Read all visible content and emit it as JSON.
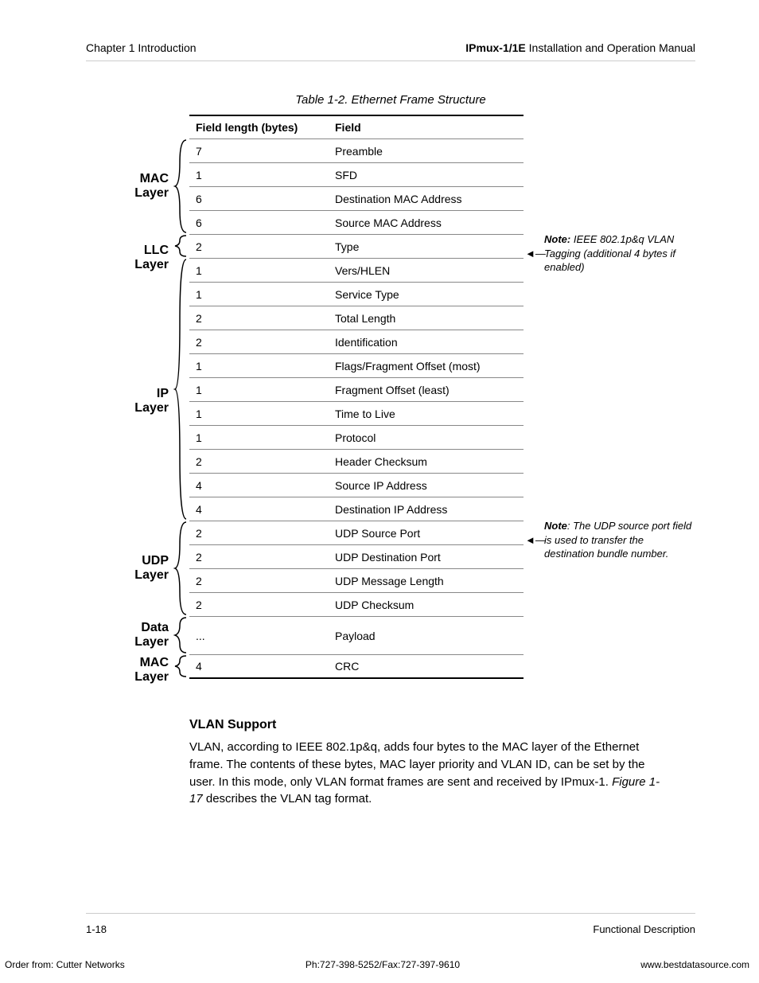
{
  "header": {
    "left": "Chapter 1  Introduction",
    "right_bold": "IPmux-1/1E",
    "right_rest": " Installation and Operation Manual"
  },
  "caption": "Table 1-2.  Ethernet Frame Structure",
  "table": {
    "head_c1": "Field length (bytes)",
    "head_c2": "Field",
    "rows": [
      {
        "len": "7",
        "field": "Preamble"
      },
      {
        "len": "1",
        "field": "SFD"
      },
      {
        "len": "6",
        "field": "Destination MAC Address"
      },
      {
        "len": "6",
        "field": "Source MAC Address"
      },
      {
        "len": "2",
        "field": "Type"
      },
      {
        "len": "1",
        "field": "Vers/HLEN"
      },
      {
        "len": "1",
        "field": "Service Type"
      },
      {
        "len": "2",
        "field": "Total Length"
      },
      {
        "len": "2",
        "field": "Identification"
      },
      {
        "len": "1",
        "field": "Flags/Fragment Offset (most)"
      },
      {
        "len": "1",
        "field": "Fragment Offset (least)"
      },
      {
        "len": "1",
        "field": "Time to Live"
      },
      {
        "len": "1",
        "field": "Protocol"
      },
      {
        "len": "2",
        "field": "Header Checksum"
      },
      {
        "len": "4",
        "field": "Source IP Address"
      },
      {
        "len": "4",
        "field": "Destination IP Address"
      },
      {
        "len": "2",
        "field": "UDP Source Port"
      },
      {
        "len": "2",
        "field": "UDP Destination Port"
      },
      {
        "len": "2",
        "field": "UDP Message Length"
      },
      {
        "len": "2",
        "field": "UDP Checksum"
      },
      {
        "len": "...",
        "field": "Payload"
      },
      {
        "len": "4",
        "field": "CRC"
      }
    ]
  },
  "layers": {
    "mac": "MAC Layer",
    "llc": "LLC Layer",
    "ip": "IP Layer",
    "udp": "UDP Layer",
    "data": "Data Layer",
    "mac2": "MAC Layer"
  },
  "notes": {
    "n1_label": "Note:",
    "n1_rest": " IEEE 802.1p&q VLAN Tagging (additional 4 bytes if enabled)",
    "n2_label": "Note",
    "n2_rest": ": The UDP source port field is used to transfer the destination bundle number."
  },
  "section": {
    "heading": "VLAN Support",
    "para_a": "VLAN, according to IEEE 802.1p&q, adds four bytes to the MAC layer of the Ethernet frame. The contents of these bytes, MAC layer priority and VLAN ID, can be set by the user. In this mode, only VLAN format frames are sent and received by IPmux-1. ",
    "para_em": "Figure 1-17",
    "para_b": " describes the VLAN tag format."
  },
  "footer": {
    "left": "1-18",
    "right": "Functional Description"
  },
  "order": {
    "left": "Order from: Cutter Networks",
    "center": "Ph:727-398-5252/Fax:727-397-9610",
    "right": "www.bestdatasource.com"
  }
}
